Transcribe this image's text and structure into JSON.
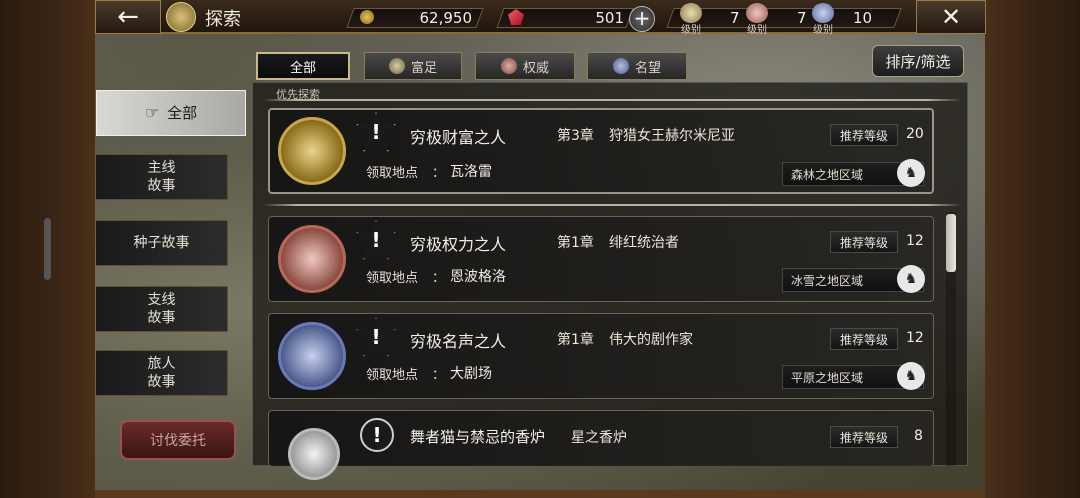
{
  "header": {
    "back_label": "←",
    "title": "探索",
    "close_label": "✕"
  },
  "currencies": {
    "gold": "62,950",
    "gems": "501",
    "plus_label": "+"
  },
  "ranks": [
    {
      "label": "级别",
      "value": "7"
    },
    {
      "label": "级别",
      "value": "7"
    },
    {
      "label": "级别",
      "value": "10"
    }
  ],
  "category_tabs": [
    {
      "label": "全部",
      "active": true
    },
    {
      "label": "富足",
      "icon": "wealth-icon"
    },
    {
      "label": "权威",
      "icon": "authority-icon"
    },
    {
      "label": "名望",
      "icon": "fame-icon"
    }
  ],
  "sort_label": "排序/筛选",
  "sidebar": {
    "items": [
      {
        "label": "全部",
        "icon": "pointing-hand-icon",
        "active": true
      },
      {
        "label": "主线\n故事"
      },
      {
        "label": "种子故事"
      },
      {
        "label": "支线\n故事"
      },
      {
        "label": "旅人\n故事"
      }
    ],
    "commission_label": "讨伐委托"
  },
  "list": {
    "section_label": "优先探索",
    "loc_label": "领取地点",
    "colon": "：",
    "rec_label": "推荐等级",
    "quests": [
      {
        "name": "穷极财富之人",
        "chapter": "第3章",
        "subtitle": "狩猎女王赫尔米尼亚",
        "level": "20",
        "location": "瓦洛雷",
        "region": "森林之地区域",
        "accent": "#c8a64a"
      },
      {
        "name": "穷极权力之人",
        "chapter": "第1章",
        "subtitle": "绯红统治者",
        "level": "12",
        "location": "恩波格洛",
        "region": "冰雪之地区域",
        "accent": "#b8685a"
      },
      {
        "name": "穷极名声之人",
        "chapter": "第1章",
        "subtitle": "伟大的剧作家",
        "level": "12",
        "location": "大剧场",
        "region": "平原之地区域",
        "accent": "#6a7ab8"
      },
      {
        "name": "舞者猫与禁忌的香炉",
        "chapter": "星之香炉",
        "level": "8"
      }
    ]
  },
  "colors": {
    "gold_accent": "#c8a64a",
    "crimson_accent": "#b8685a",
    "blue_accent": "#6a7ab8"
  }
}
